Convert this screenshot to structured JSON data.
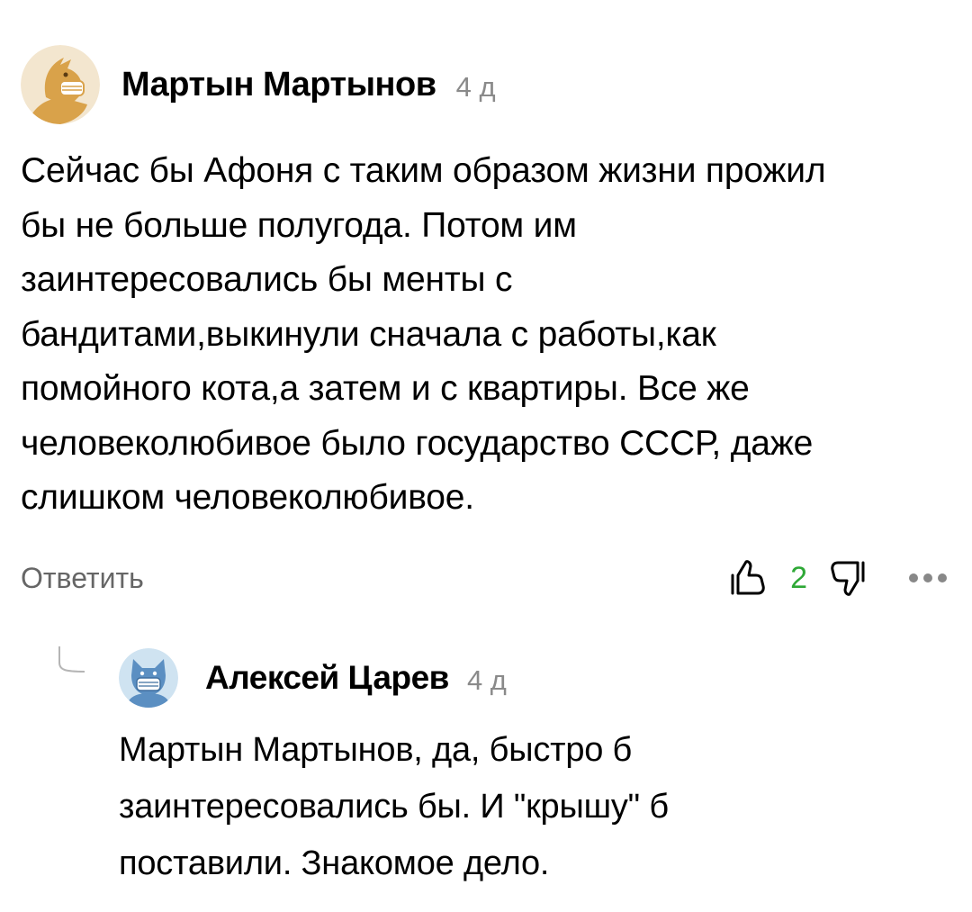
{
  "comments": [
    {
      "author": "Мартын Мартынов",
      "time": "4 д",
      "avatar": "bird-mask-icon",
      "lines": [
        "Сейчас бы Афоня с таким образом жизни прожил",
        "бы не больше полугода. Потом им",
        "заинтересовались бы менты с",
        "бандитами,выкинули сначала с работы,как",
        "помойного кота,а затем и с квартиры. Все же",
        "человеколюбивое было государство СССР, даже",
        "слишком человеколюбивое."
      ],
      "reply_label": "Ответить",
      "likes": "2"
    },
    {
      "author": "Алексей Царев",
      "time": "4 д",
      "avatar": "cat-mask-icon",
      "lines": [
        "Мартын Мартынов, да, быстро б",
        "заинтересовались бы. И \"крышу\" б",
        "поставили. Знакомое дело."
      ]
    }
  ],
  "colors": {
    "like_count": "#2ea836",
    "muted": "#8a8a8a",
    "avatar1_bg": "#f3e6cf",
    "avatar1_fg": "#d9a24a",
    "avatar2_bg": "#cfe3f1",
    "avatar2_fg": "#5b8fc2"
  },
  "icons": [
    "thumb-up-icon",
    "thumb-down-icon",
    "more-dots-icon",
    "thread-line-icon"
  ]
}
